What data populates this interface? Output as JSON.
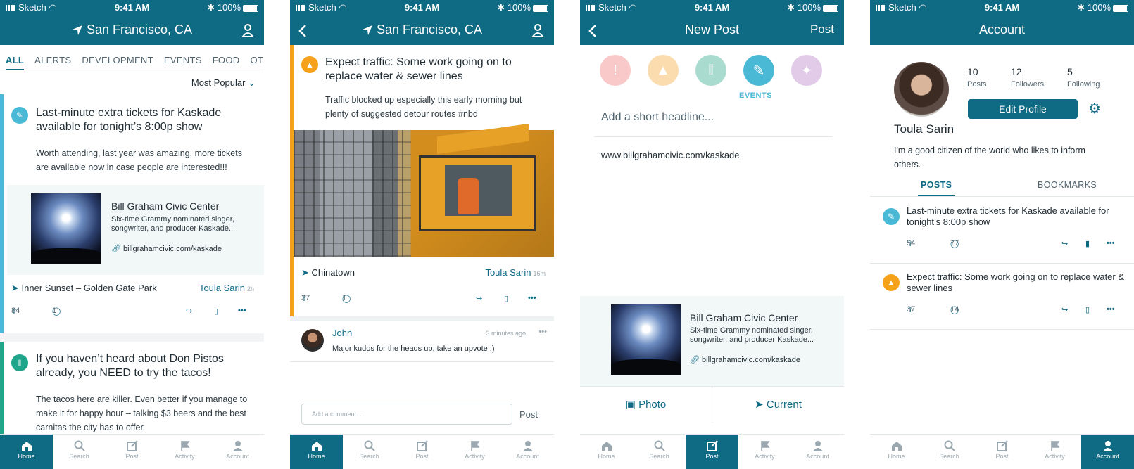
{
  "status": {
    "carrier": "Sketch",
    "time": "9:41 AM",
    "battery": "100%"
  },
  "tabs": [
    {
      "label": "Home",
      "icon": "home-icon"
    },
    {
      "label": "Search",
      "icon": "search-icon"
    },
    {
      "label": "Post",
      "icon": "compose-icon"
    },
    {
      "label": "Activity",
      "icon": "flag-icon"
    },
    {
      "label": "Account",
      "icon": "person-icon"
    }
  ],
  "colors": {
    "brand": "#0f6a84",
    "events": "#4ab9d6",
    "food": "#1fa68a",
    "alerts": "#f5a21a",
    "danger": "#f07a7a"
  },
  "feed": {
    "location": "San Francisco, CA",
    "filters": [
      "ALL",
      "ALERTS",
      "DEVELOPMENT",
      "EVENTS",
      "FOOD",
      "OTHER"
    ],
    "sort": "Most Popular",
    "post1": {
      "headline": "Last-minute extra tickets for Kaskade available for tonight’s 8:00p show",
      "body": "Worth attending, last year was amazing, more tickets are available now in case people are interested!!!",
      "link_title": "Bill Graham Civic Center",
      "link_desc": "Six-time Grammy nominated singer, songwriter, and producer Kaskade...",
      "link_url": "billgrahamcivic.com/kaskade",
      "location": "Inner Sunset – Golden Gate Park",
      "author": "Toula Sarin",
      "time": "2h",
      "upvotes": "84",
      "comments": "1"
    },
    "post2": {
      "headline": "If you haven’t heard about Don Pistos already, you NEED to try the tacos!",
      "body": "The tacos here are killer. Even better if you manage to make it for happy hour – talking $3 beers and the best carnitas the city has to offer."
    }
  },
  "detail": {
    "location": "San Francisco, CA",
    "headline": "Expect traffic: Some work going on to replace water & sewer lines",
    "body": "Traffic blocked up especially this early morning but plenty of suggested detour routes #nbd",
    "place": "Chinatown",
    "author": "Toula Sarin",
    "time": "16m",
    "upvotes": "37",
    "comments": "1",
    "comment_author": "John",
    "comment_time": "3 minutes ago",
    "comment_text": "Major kudos for the heads up; take an upvote :)",
    "comment_placeholder": "Add a comment...",
    "comment_post": "Post"
  },
  "new_post": {
    "title": "New Post",
    "post_label": "Post",
    "selected_category": "EVENTS",
    "headline_placeholder": "Add a short headline...",
    "body_value": "www.billgrahamcivic.com/kaskade",
    "link_title": "Bill Graham Civic Center",
    "link_desc": "Six-time Grammy nominated singer, songwriter, and producer Kaskade...",
    "link_url": "billgrahamcivic.com/kaskade",
    "photo_label": "Photo",
    "current_label": "Current"
  },
  "account": {
    "title": "Account",
    "posts_count": "10",
    "posts_label": "Posts",
    "followers_count": "12",
    "followers_label": "Followers",
    "following_count": "5",
    "following_label": "Following",
    "edit_label": "Edit Profile",
    "name": "Toula Sarin",
    "bio": "I'm a good citizen of the world who likes to inform others.",
    "tab_posts": "POSTS",
    "tab_bookmarks": "BOOKMARKS",
    "post1": {
      "headline": "Last-minute extra tickets for Kaskade available for tonight’s 8:00p show",
      "upvotes": "54",
      "comments": "77"
    },
    "post2": {
      "headline": "Expect traffic: Some work going on to replace water & sewer lines",
      "upvotes": "37",
      "comments": "14"
    }
  }
}
